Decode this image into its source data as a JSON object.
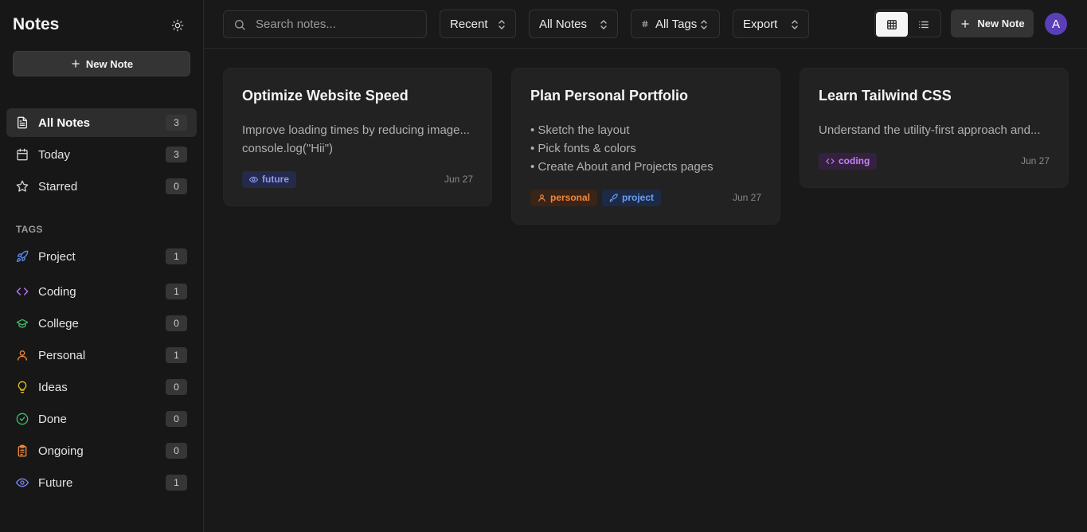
{
  "sidebar": {
    "brand": "Notes",
    "new_note_label": "New Note",
    "nav": [
      {
        "label": "All Notes",
        "count": "3"
      },
      {
        "label": "Today",
        "count": "3"
      },
      {
        "label": "Starred",
        "count": "0"
      }
    ],
    "tags_heading": "TAGS",
    "tags": [
      {
        "label": "Project",
        "count": "1",
        "icon": "rocket-icon",
        "color": "#5b8def"
      },
      {
        "label": "Coding",
        "count": "1",
        "icon": "code-icon",
        "color": "#b67cf0"
      },
      {
        "label": "College",
        "count": "0",
        "icon": "graduation-cap-icon",
        "color": "#3fbf6b"
      },
      {
        "label": "Personal",
        "count": "1",
        "icon": "user-icon",
        "color": "#f0883e"
      },
      {
        "label": "Ideas",
        "count": "0",
        "icon": "lightbulb-icon",
        "color": "#e6c229"
      },
      {
        "label": "Done",
        "count": "0",
        "icon": "check-circle-icon",
        "color": "#3fbf6b"
      },
      {
        "label": "Ongoing",
        "count": "0",
        "icon": "clipboard-icon",
        "color": "#f0883e"
      },
      {
        "label": "Future",
        "count": "1",
        "icon": "eye-icon",
        "color": "#7b86f0"
      }
    ]
  },
  "topbar": {
    "search_placeholder": "Search notes...",
    "sort_label": "Recent",
    "filter_label": "All Notes",
    "tags_filter_label": "All Tags",
    "export_label": "Export",
    "new_note_label": "New Note",
    "avatar_initial": "A"
  },
  "notes": [
    {
      "title": "Optimize Website Speed",
      "lines": [
        "Improve loading times by reducing image...",
        "console.log(\"Hii\")"
      ],
      "tags": [
        {
          "label": "future",
          "icon": "eye-icon"
        }
      ],
      "date": "Jun 27"
    },
    {
      "title": "Plan Personal Portfolio",
      "lines": [
        "• Sketch the layout",
        "• Pick fonts & colors",
        "• Create About and Projects pages"
      ],
      "tags": [
        {
          "label": "personal",
          "icon": "user-icon"
        },
        {
          "label": "project",
          "icon": "rocket-icon"
        }
      ],
      "date": "Jun 27"
    },
    {
      "title": "Learn Tailwind CSS",
      "lines": [
        "Understand the utility-first approach and..."
      ],
      "tags": [
        {
          "label": "coding",
          "icon": "code-icon"
        }
      ],
      "date": "Jun 27"
    }
  ],
  "colors": {
    "background": "#191919",
    "card": "#222222",
    "avatar": "#5b3fb8",
    "tag_future_bg": "#242a4a",
    "tag_future_fg": "#8f98f5",
    "tag_personal_bg": "#3a2417",
    "tag_personal_fg": "#f0883e",
    "tag_project_bg": "#1d2a45",
    "tag_project_fg": "#6aa0f5",
    "tag_coding_bg": "#34213f",
    "tag_coding_fg": "#c184f2"
  }
}
